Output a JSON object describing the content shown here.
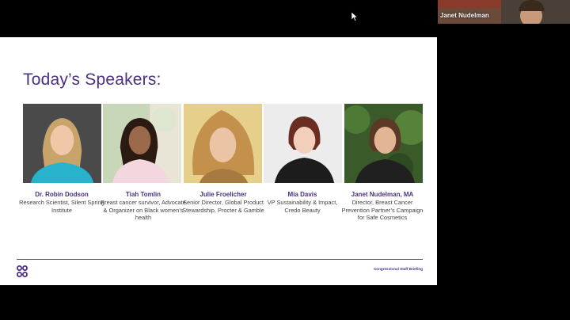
{
  "slide": {
    "title": "Today’s Speakers:",
    "footer_tag": "Congressional Staff Briefing",
    "colors": {
      "accent": "#4b2f82",
      "rule": "#6a4fa5"
    },
    "speakers": [
      {
        "name": "Dr. Robin Dodson",
        "desc": "Research Scientist, Silent Spring Institute"
      },
      {
        "name": "Tiah Tomlin",
        "desc": "Breast cancer survivor, Advocate & Organizer on Black women’s health"
      },
      {
        "name": "Julie Froelicher",
        "desc": "Senior Director, Global Product Stewardship, Procter & Gamble"
      },
      {
        "name": "Mia Davis",
        "desc": "VP Sustainability & Impact, Credo Beauty"
      },
      {
        "name": "Janet Nudelman, MA",
        "desc": "Director, Breast Cancer Prevention Partner’s Campaign for Safe Cosmetics"
      }
    ]
  },
  "video": {
    "participant_name": "Janet Nudelman"
  }
}
